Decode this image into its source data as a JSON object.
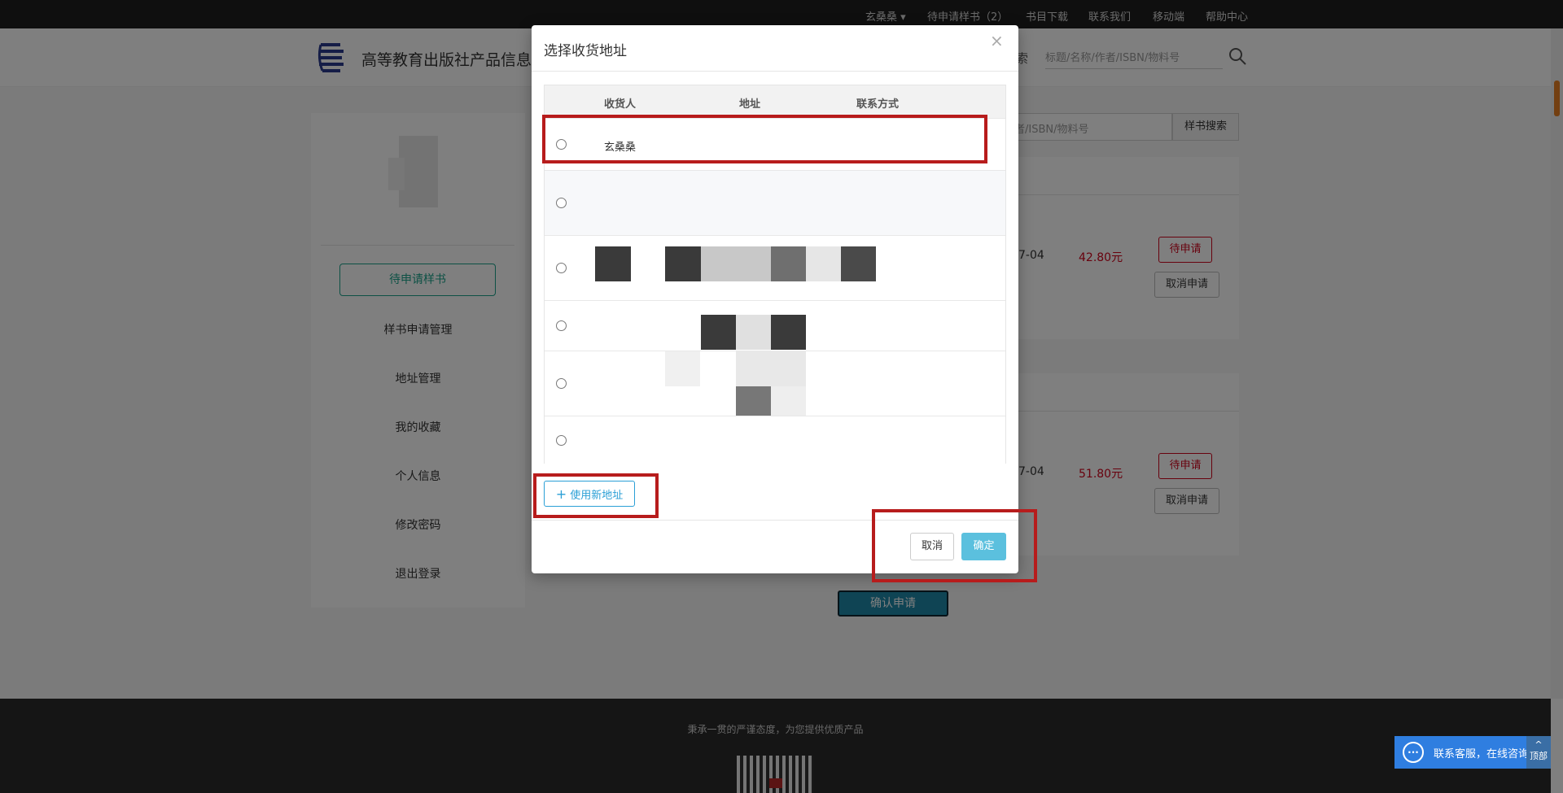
{
  "topbar": {
    "user": "玄桑桑",
    "pending": "待申请样书（2）",
    "catalog": "书目下载",
    "contact": "联系我们",
    "mobile": "移动端",
    "help": "帮助中心"
  },
  "header": {
    "site_title": "高等教育出版社产品信息检",
    "search_placeholder": "标题/名称/作者/ISBN/物料号",
    "search_cut": "索"
  },
  "sidebar": {
    "active": "待申请样书",
    "items": [
      "样书申请管理",
      "地址管理",
      "我的收藏",
      "个人信息",
      "修改密码",
      "退出登录"
    ]
  },
  "content": {
    "search_placeholder": "者/ISBN/物料号",
    "search_button": "样书搜索",
    "cards": [
      {
        "date": "7-04",
        "price": "42.80元",
        "pending_btn": "待申请",
        "cancel_btn": "取消申请"
      },
      {
        "date": "7-04",
        "price": "51.80元",
        "pending_btn": "待申请",
        "cancel_btn": "取消申请"
      }
    ],
    "confirm_apply": "确认申请"
  },
  "modal": {
    "title": "选择收货地址",
    "close": "×",
    "columns": [
      "收货人",
      "地址",
      "联系方式"
    ],
    "rows": [
      {
        "name": "玄桑桑"
      },
      {
        "name": ""
      },
      {
        "name": ""
      },
      {
        "name": ""
      },
      {
        "name": ""
      },
      {
        "name": ""
      }
    ],
    "new_address_button": "使用新地址",
    "cancel_button": "取消",
    "ok_button": "确定"
  },
  "footer": {
    "slogan": "秉承一贯的严谨态度，为您提供优质产品"
  },
  "chat": {
    "icon": "···",
    "label": "联系客服，在线咨询",
    "back_top": "顶部"
  },
  "colors": {
    "accent_green": "#1aa28b",
    "price_red": "#d0021b",
    "modal_ok": "#5bc0de",
    "annotation_red": "#b71c1c"
  }
}
